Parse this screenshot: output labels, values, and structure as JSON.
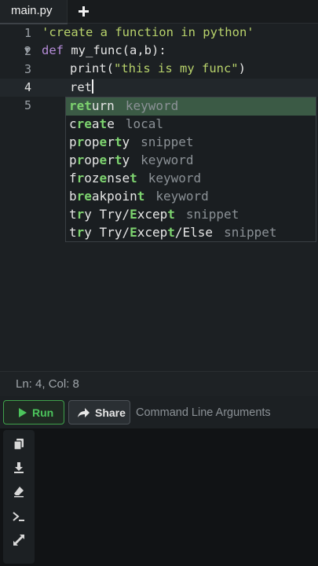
{
  "tabs": [
    {
      "label": "main.py"
    }
  ],
  "editor": {
    "lines": [
      {
        "num": "1"
      },
      {
        "num": "2"
      },
      {
        "num": "3"
      },
      {
        "num": "4"
      },
      {
        "num": "5"
      }
    ],
    "code": {
      "line1": "'create a function in python'",
      "line2_kw": "def",
      "line2_rest": " my_func(a,b):",
      "line3_fn": "print(",
      "line3_str": "\"this is my func\"",
      "line3_close": ")",
      "line4": "ret"
    }
  },
  "autocomplete": [
    {
      "match": "ret",
      "rest": "urn",
      "kind": "keyword"
    },
    {
      "pre": "c",
      "match": "re",
      "mid": "a",
      "match2": "t",
      "rest": "e",
      "kind": "local"
    },
    {
      "pre": "p",
      "match": "r",
      "mid": "op",
      "match2": "e",
      "mid2": "r",
      "match3": "t",
      "rest": "y",
      "kind": "snippet"
    },
    {
      "pre": "p",
      "match": "r",
      "mid": "op",
      "match2": "e",
      "mid2": "r",
      "match3": "t",
      "rest": "y",
      "kind": "keyword"
    },
    {
      "pre": "f",
      "match": "r",
      "mid": "oz",
      "match2": "e",
      "mid2": "nse",
      "match3": "t",
      "rest": "",
      "kind": "keyword"
    },
    {
      "pre": "b",
      "match": "re",
      "mid": "akpoin",
      "match2": "t",
      "rest": "",
      "kind": "keyword"
    },
    {
      "pre": "t",
      "match": "r",
      "mid": "y Try/",
      "match2": "E",
      "mid2": "xcep",
      "match3": "t",
      "rest": "",
      "kind": "snippet"
    },
    {
      "pre": "t",
      "match": "r",
      "mid": "y Try/",
      "match2": "E",
      "mid2": "xcep",
      "match3": "t",
      "rest": "/Else",
      "kind": "snippet"
    }
  ],
  "status": {
    "position": "Ln: 4,  Col: 8"
  },
  "toolbar": {
    "run_label": "Run",
    "share_label": "Share",
    "args_placeholder": "Command Line Arguments"
  },
  "console": {
    "rail_icons": [
      "copy-icon",
      "download-icon",
      "eraser-icon",
      "terminal-icon",
      "expand-icon"
    ]
  },
  "colors": {
    "accent_green": "#4cc55c",
    "selection": "#3b5a45",
    "match_green": "#7dd36f",
    "string": "#b8d26b",
    "keyword": "#b58cd8"
  }
}
